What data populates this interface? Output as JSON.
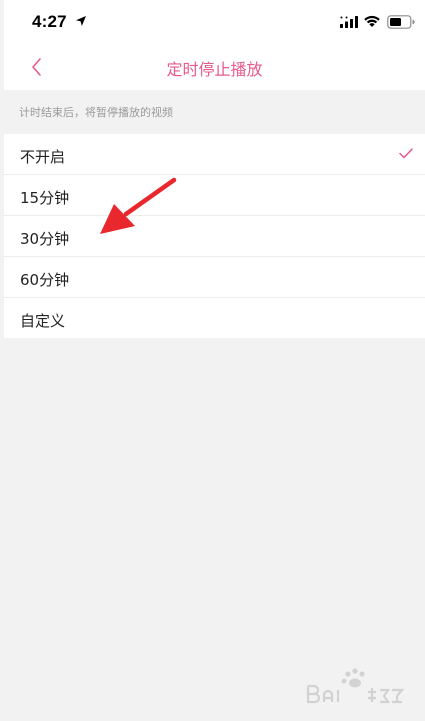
{
  "status_bar": {
    "time": "4:27"
  },
  "nav": {
    "title": "定时停止播放"
  },
  "section_header": "计时结束后，将暂停播放的视频",
  "options": [
    {
      "label": "不开启",
      "selected": true
    },
    {
      "label": "15分钟",
      "selected": false
    },
    {
      "label": "30分钟",
      "selected": false
    },
    {
      "label": "60分钟",
      "selected": false
    },
    {
      "label": "自定义",
      "selected": false
    }
  ],
  "colors": {
    "accent": "#e95a8c",
    "annotation": "#e8282c",
    "background": "#f2f2f3"
  },
  "icons": {
    "back": "chevron-left-icon",
    "check": "check-icon",
    "location": "location-arrow-icon",
    "signal": "cellular-signal-icon",
    "wifi": "wifi-icon",
    "battery": "battery-icon"
  }
}
